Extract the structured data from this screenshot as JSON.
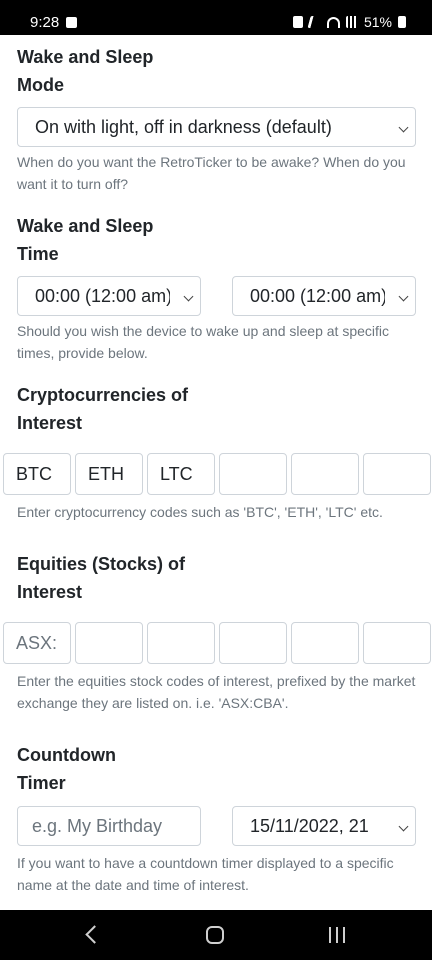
{
  "status": {
    "time": "9:28",
    "battery": "51%",
    "icons": [
      "image-icon",
      "battery-saver-icon",
      "mute-icon",
      "wifi-icon",
      "signal-icon",
      "battery-icon"
    ]
  },
  "wake_mode": {
    "title_line1": "Wake and Sleep",
    "title_line2": "Mode",
    "selected": "On with light, off in darkness (default)",
    "help": "When do you want the RetroTicker to be awake? When do you want it to turn off?"
  },
  "wake_time": {
    "title_line1": "Wake and Sleep",
    "title_line2": "Time",
    "wake_selected": "00:00 (12:00 am)",
    "sleep_selected": "00:00 (12:00 am)",
    "help": "Should you wish the device to wake up and sleep at specific times, provide below."
  },
  "crypto": {
    "title_line1": "Cryptocurrencies of",
    "title_line2": "Interest",
    "codes": [
      "BTC",
      "ETH",
      "LTC",
      "",
      "",
      ""
    ],
    "help": "Enter cryptocurrency codes such as 'BTC', 'ETH', 'LTC' etc."
  },
  "equities": {
    "title_line1": "Equities (Stocks) of",
    "title_line2": "Interest",
    "codes_placeholder": [
      "ASX:",
      "",
      "",
      "",
      "",
      ""
    ],
    "help": "Enter the equities stock codes of interest, prefixed by the market exchange they are listed on. i.e. 'ASX:CBA'."
  },
  "countdown": {
    "title_line1": "Countdown",
    "title_line2": "Timer",
    "name_placeholder": "e.g. My Birthday",
    "datetime_selected": "15/11/2022, 21",
    "help": "If you want to have a countdown timer displayed to a specific name at the date and time of interest."
  },
  "nav": {
    "icons": [
      "back-icon",
      "home-icon",
      "recents-icon"
    ]
  }
}
